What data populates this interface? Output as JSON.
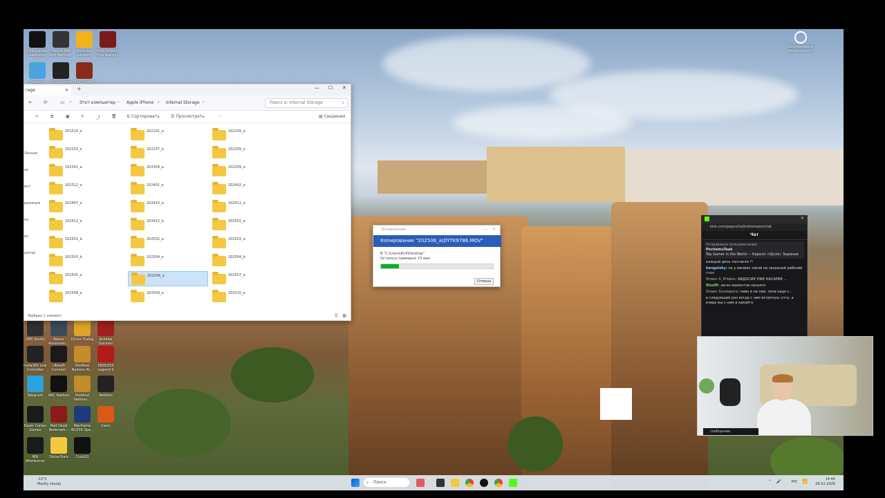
{
  "desktop": {
    "top_icons": [
      {
        "label": "Epic Games\nLauncher",
        "color": "#111"
      },
      {
        "label": "Hearts Will\nRoll Battlegr.",
        "color": "#333"
      },
      {
        "label": "Rockstar\nGames...",
        "color": "#f2b21b"
      },
      {
        "label": "Hunt:Showdn\nCrucible of...",
        "color": "#7a1a1a"
      },
      {
        "label": "Корзина",
        "color": "#4aa3df"
      },
      {
        "label": "Ghost Recon",
        "color": "#222"
      },
      {
        "label": "Max Payne 3",
        "color": "#8a2b1a"
      }
    ],
    "bottom_icons": [
      {
        "label": "OBS Studio",
        "color": "#302e31"
      },
      {
        "label": "Nexus\nAscension...",
        "color": "#3b4a5a"
      },
      {
        "label": "Dictor Dialog",
        "color": "#e0a32a"
      },
      {
        "label": "Achilles\nSurvivor",
        "color": "#a02020"
      },
      {
        "label": "Insta360 Link\nController",
        "color": "#222"
      },
      {
        "label": "Ubisoft\nConnect",
        "color": "#1a1a1a"
      },
      {
        "label": "Holdfast\nNations At...",
        "color": "#c28b2c"
      },
      {
        "label": "ENDLESS\nLegend 2",
        "color": "#b31b1b"
      },
      {
        "label": "Telegram",
        "color": "#2aa3df"
      },
      {
        "label": "ARC Raiders",
        "color": "#111"
      },
      {
        "label": "Holdfast\nNations...",
        "color": "#c28b2c"
      },
      {
        "label": "Aethero",
        "color": "#222"
      },
      {
        "label": "Razer Cortex\nGames",
        "color": "#1a1a1a"
      },
      {
        "label": "Red Dead\nRedempti...",
        "color": "#8b1a1a"
      },
      {
        "label": "Warframe\n40,000 Spa...",
        "color": "#1d3b7a"
      },
      {
        "label": "Cairn",
        "color": "#d9581a"
      },
      {
        "label": "MSI\nAfterburner",
        "color": "#1a1a1a"
      },
      {
        "label": "DictorDialo",
        "color": "#f5c842"
      },
      {
        "label": "ClubGG",
        "color": "#111"
      }
    ],
    "right_icon": {
      "label": "Восстановить\nбезопасность"
    }
  },
  "explorer": {
    "tab_label": "rage",
    "breadcrumbs": [
      "Этот компьютер",
      "Apple iPhone",
      "Internal Storage"
    ],
    "search_placeholder": "Поиск в: Internal Storage",
    "toolbar": {
      "sort": "Сортировать",
      "view": "Просмотреть",
      "more": "···",
      "details": "Сведения"
    },
    "sidebar": [
      "Личное",
      "ов",
      "ент",
      "ражения",
      "ка",
      "ео",
      "ьютер"
    ],
    "folders": [
      "201510_a",
      "202101_a",
      "202109_a",
      "202203_a",
      "202207_a",
      "202209_a",
      "202301_a",
      "202304_a",
      "202309_a",
      "202312_a",
      "202401_a",
      "202402_a",
      "202407_a",
      "202410_a",
      "202411_a",
      "202412_a",
      "202412_b",
      "202501_a",
      "202501_b",
      "202502_a",
      "202503_a",
      "202503_b",
      "202504_a",
      "202504_b",
      "202505_a",
      "202506_a",
      "202507_a",
      "202508_a",
      "202509_a",
      "202510_a"
    ],
    "selected_index": 25,
    "status": "Выбран 1 элемент"
  },
  "copy_dialog": {
    "window_title": "Копирование",
    "heading": "Копирование \"202506_a\\DYTK9786.MOV\"",
    "path": "В \"C:\\Users\\Kiril\\Desktop\"",
    "remaining": "Осталось примерно 23 мин",
    "progress": 0.16,
    "cancel": "Отмена"
  },
  "chat": {
    "url": "kick.com/popout/vjlinkheroyes/chat",
    "title": "Чат",
    "pinned_by": "Отправлено пользователем",
    "pinned_user": "PochemuTaak",
    "pinned_text": "Top Gamer in the World — Кирилл «VJLink» Зырянов",
    "messages": [
      {
        "user": "",
        "text": "каждый день тентакли ?!",
        "color": "#ddd"
      },
      {
        "user": "bengalsky:",
        "text": "не у мениих такой не засраный рабочий стол",
        "color": "#8fc7ff"
      },
      {
        "user": "Ответ S_Prldnx:",
        "text": "ВИДОСИК УЖЕ КАСАРИК ...",
        "color": "#888"
      },
      {
        "user": "KhelM:",
        "text": "загон мамонтов начался",
        "color": "#7cd36b"
      },
      {
        "user": "Ответ Scompars:",
        "text": "пиво и не пей, типа надо с...",
        "color": "#888"
      },
      {
        "user": "",
        "text": "в следующий раз когда с ним встречусь учту, а вчера мы с ним в какойто",
        "color": "#ddd"
      }
    ],
    "input_placeholder": "сообщение"
  },
  "taskbar": {
    "weather_temp": "-12°C",
    "weather_desc": "Mostly cloudy",
    "search": "Поиск",
    "lang": "РУС",
    "time": "14:44",
    "date": "08.02.2026"
  }
}
